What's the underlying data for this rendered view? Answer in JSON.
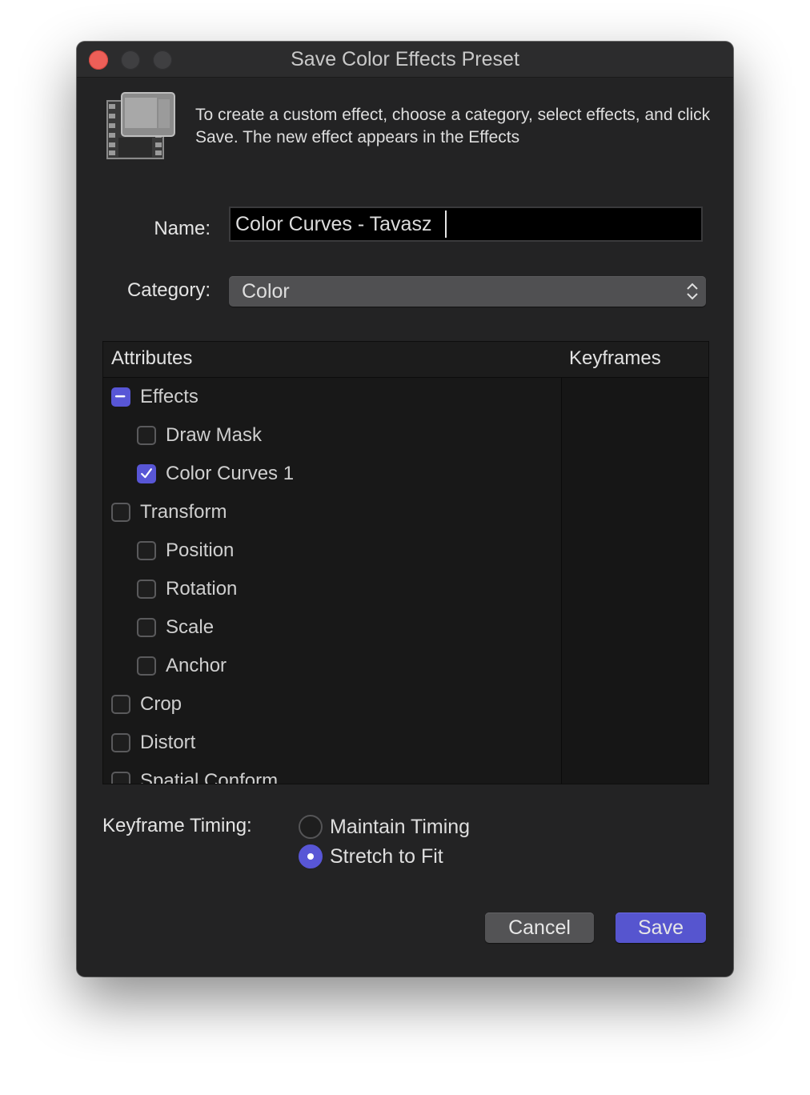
{
  "window": {
    "title": "Save Color Effects Preset"
  },
  "intro": {
    "text": "To create a custom effect, choose a category, select effects, and click Save. The new effect appears in the Effects"
  },
  "form": {
    "name_label": "Name:",
    "name_value": "Color Curves - Tavasz",
    "category_label": "Category:",
    "category_value": "Color"
  },
  "table": {
    "col_attributes": "Attributes",
    "col_keyframes": "Keyframes",
    "rows": [
      {
        "label": "Effects",
        "state": "mixed",
        "indent": 0
      },
      {
        "label": "Draw Mask",
        "state": "off",
        "indent": 1
      },
      {
        "label": "Color Curves 1",
        "state": "on",
        "indent": 1
      },
      {
        "label": "Transform",
        "state": "off",
        "indent": 0
      },
      {
        "label": "Position",
        "state": "off",
        "indent": 1
      },
      {
        "label": "Rotation",
        "state": "off",
        "indent": 1
      },
      {
        "label": "Scale",
        "state": "off",
        "indent": 1
      },
      {
        "label": "Anchor",
        "state": "off",
        "indent": 1
      },
      {
        "label": "Crop",
        "state": "off",
        "indent": 0
      },
      {
        "label": "Distort",
        "state": "off",
        "indent": 0
      },
      {
        "label": "Spatial Conform",
        "state": "off",
        "indent": 0
      }
    ]
  },
  "timing": {
    "label": "Keyframe Timing:",
    "options": [
      {
        "label": "Maintain Timing",
        "selected": false
      },
      {
        "label": "Stretch to Fit",
        "selected": true
      }
    ]
  },
  "buttons": {
    "cancel": "Cancel",
    "save": "Save"
  },
  "colors": {
    "accent": "#5856d6",
    "close": "#ed5f58",
    "window_bg": "#232324"
  },
  "icons": [
    "close-icon",
    "minimize-icon",
    "zoom-icon",
    "film-preset-icon",
    "updown-chevron-icon",
    "checkmark-icon",
    "minus-icon"
  ]
}
